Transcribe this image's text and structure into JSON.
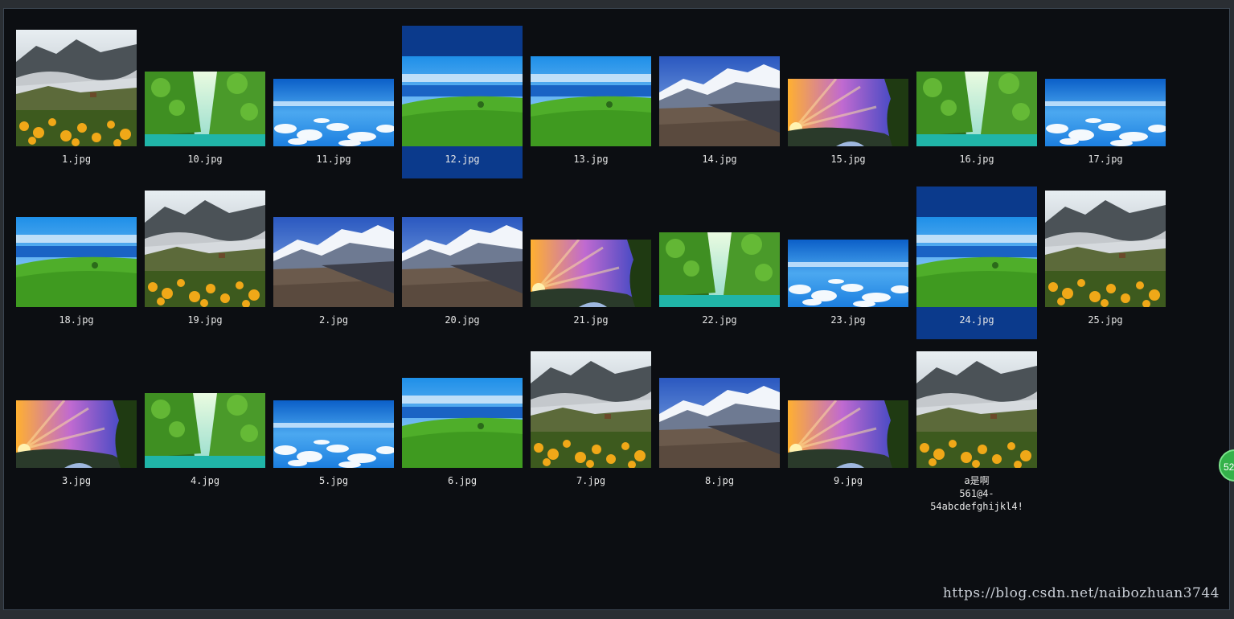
{
  "gallery": {
    "items": [
      {
        "caption": "1.jpg",
        "scene": "mist-mountain-flowers-image",
        "selected": false
      },
      {
        "caption": "10.jpg",
        "scene": "green-gorge-waterfall-image",
        "selected": false
      },
      {
        "caption": "11.jpg",
        "scene": "sky-clouds-image",
        "selected": false
      },
      {
        "caption": "12.jpg",
        "scene": "green-meadow-sea-image",
        "selected": true
      },
      {
        "caption": "13.jpg",
        "scene": "green-meadow-sea-image",
        "selected": false
      },
      {
        "caption": "14.jpg",
        "scene": "snowy-mountains-image",
        "selected": false
      },
      {
        "caption": "15.jpg",
        "scene": "sunset-valley-image",
        "selected": false
      },
      {
        "caption": "16.jpg",
        "scene": "green-gorge-waterfall-image",
        "selected": false
      },
      {
        "caption": "17.jpg",
        "scene": "sky-clouds-image",
        "selected": false
      },
      {
        "caption": "18.jpg",
        "scene": "green-meadow-sea-image",
        "selected": false
      },
      {
        "caption": "19.jpg",
        "scene": "mist-mountain-flowers-image",
        "selected": false
      },
      {
        "caption": "2.jpg",
        "scene": "snowy-mountains-image",
        "selected": false
      },
      {
        "caption": "20.jpg",
        "scene": "snowy-mountains-image",
        "selected": false
      },
      {
        "caption": "21.jpg",
        "scene": "sunset-valley-image",
        "selected": false
      },
      {
        "caption": "22.jpg",
        "scene": "green-gorge-waterfall-image",
        "selected": false
      },
      {
        "caption": "23.jpg",
        "scene": "sky-clouds-image",
        "selected": false
      },
      {
        "caption": "24.jpg",
        "scene": "green-meadow-sea-image",
        "selected": true
      },
      {
        "caption": "25.jpg",
        "scene": "mist-mountain-flowers-image",
        "selected": false
      },
      {
        "caption": "3.jpg",
        "scene": "sunset-valley-image",
        "selected": false
      },
      {
        "caption": "4.jpg",
        "scene": "green-gorge-waterfall-image",
        "selected": false
      },
      {
        "caption": "5.jpg",
        "scene": "sky-clouds-image",
        "selected": false
      },
      {
        "caption": "6.jpg",
        "scene": "green-meadow-sea-image",
        "selected": false
      },
      {
        "caption": "7.jpg",
        "scene": "mist-mountain-flowers-image",
        "selected": false
      },
      {
        "caption": "8.jpg",
        "scene": "snowy-mountains-image",
        "selected": false
      },
      {
        "caption": "9.jpg",
        "scene": "sunset-valley-image",
        "selected": false
      },
      {
        "caption": "a是啊\n561@4-54abcdefghijkl4!",
        "scene": "mist-mountain-flowers-image",
        "selected": false
      }
    ]
  },
  "float_badge": {
    "text": "52"
  },
  "watermark": {
    "text": "https://blog.csdn.net/naibozhuan3744"
  },
  "colors": {
    "background": "#0c0e12",
    "selection": "#0b3a8c",
    "caption": "#e6e6e6"
  }
}
